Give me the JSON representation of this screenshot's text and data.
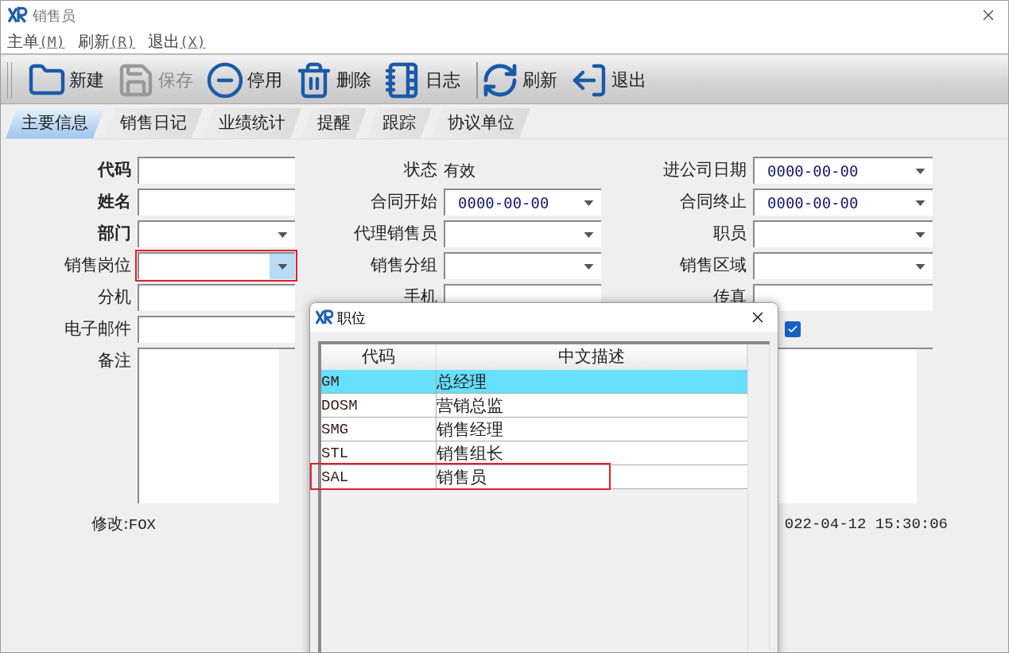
{
  "window": {
    "title": "销售员"
  },
  "menu": [
    {
      "label": "主单",
      "key": "(M)"
    },
    {
      "label": "刷新",
      "key": "(R)"
    },
    {
      "label": "退出",
      "key": "(X)"
    }
  ],
  "toolbar": [
    {
      "kind": "new",
      "label": "新建",
      "disabled": false
    },
    {
      "kind": "save",
      "label": "保存",
      "disabled": true
    },
    {
      "kind": "deactivate",
      "label": "停用",
      "disabled": false
    },
    {
      "kind": "delete",
      "label": "删除",
      "disabled": false
    },
    {
      "kind": "log",
      "label": "日志",
      "disabled": false
    },
    {
      "kind": "separator"
    },
    {
      "kind": "refresh",
      "label": "刷新",
      "disabled": false
    },
    {
      "kind": "exit",
      "label": "退出",
      "disabled": false
    }
  ],
  "tabs": [
    {
      "label": "主要信息",
      "selected": true
    },
    {
      "label": "销售日记",
      "selected": false
    },
    {
      "label": "业绩统计",
      "selected": false
    },
    {
      "label": "提醒",
      "selected": false
    },
    {
      "label": "跟踪",
      "selected": false
    },
    {
      "label": "协议单位",
      "selected": false
    }
  ],
  "form": {
    "rows": [
      [
        {
          "label": "代码",
          "bold": true,
          "kind": "input"
        },
        {
          "label": "状态",
          "bold": false,
          "kind": "text",
          "value": "有效"
        },
        {
          "label": "进公司日期",
          "bold": false,
          "kind": "date",
          "value": "0000-00-00"
        }
      ],
      [
        {
          "label": "姓名",
          "bold": true,
          "kind": "input"
        },
        {
          "label": "合同开始",
          "bold": false,
          "kind": "date",
          "value": "0000-00-00"
        },
        {
          "label": "合同终止",
          "bold": false,
          "kind": "date",
          "value": "0000-00-00"
        }
      ],
      [
        {
          "label": "部门",
          "bold": true,
          "kind": "combo"
        },
        {
          "label": "代理销售员",
          "bold": false,
          "kind": "combo"
        },
        {
          "label": "职员",
          "bold": false,
          "kind": "combo"
        }
      ],
      [
        {
          "label": "销售岗位",
          "bold": false,
          "kind": "combo",
          "highlighted": true
        },
        {
          "label": "销售分组",
          "bold": false,
          "kind": "combo"
        },
        {
          "label": "销售区域",
          "bold": false,
          "kind": "combo"
        }
      ],
      [
        {
          "label": "分机",
          "bold": false,
          "kind": "input"
        },
        {
          "label": "手机",
          "bold": false,
          "kind": "input"
        },
        {
          "label": "传真",
          "bold": false,
          "kind": "input"
        }
      ],
      [
        {
          "label": "电子邮件",
          "bold": false,
          "kind": "input"
        },
        {
          "kind": "hidden"
        },
        {
          "kind": "checkbox",
          "checked": true
        }
      ],
      [
        {
          "label": "备注",
          "bold": false,
          "kind": "textarea"
        },
        {
          "kind": "hidden"
        },
        {
          "kind": "textarea"
        }
      ]
    ],
    "modified_by": {
      "label": "修改:",
      "value": "FOX"
    },
    "modified_time": "022-04-12 15:30:06"
  },
  "dialog": {
    "title": "职位",
    "columns": [
      "代码",
      "中文描述"
    ],
    "rows": [
      {
        "code": "GM",
        "desc": "总经理",
        "selected": true,
        "highlighted": false
      },
      {
        "code": "DOSM",
        "desc": "营销总监",
        "selected": false,
        "highlighted": false
      },
      {
        "code": "SMG",
        "desc": "销售经理",
        "selected": false,
        "highlighted": false
      },
      {
        "code": "STL",
        "desc": "销售组长",
        "selected": false,
        "highlighted": false
      },
      {
        "code": "SAL",
        "desc": "销售员",
        "selected": false,
        "highlighted": true
      }
    ]
  }
}
